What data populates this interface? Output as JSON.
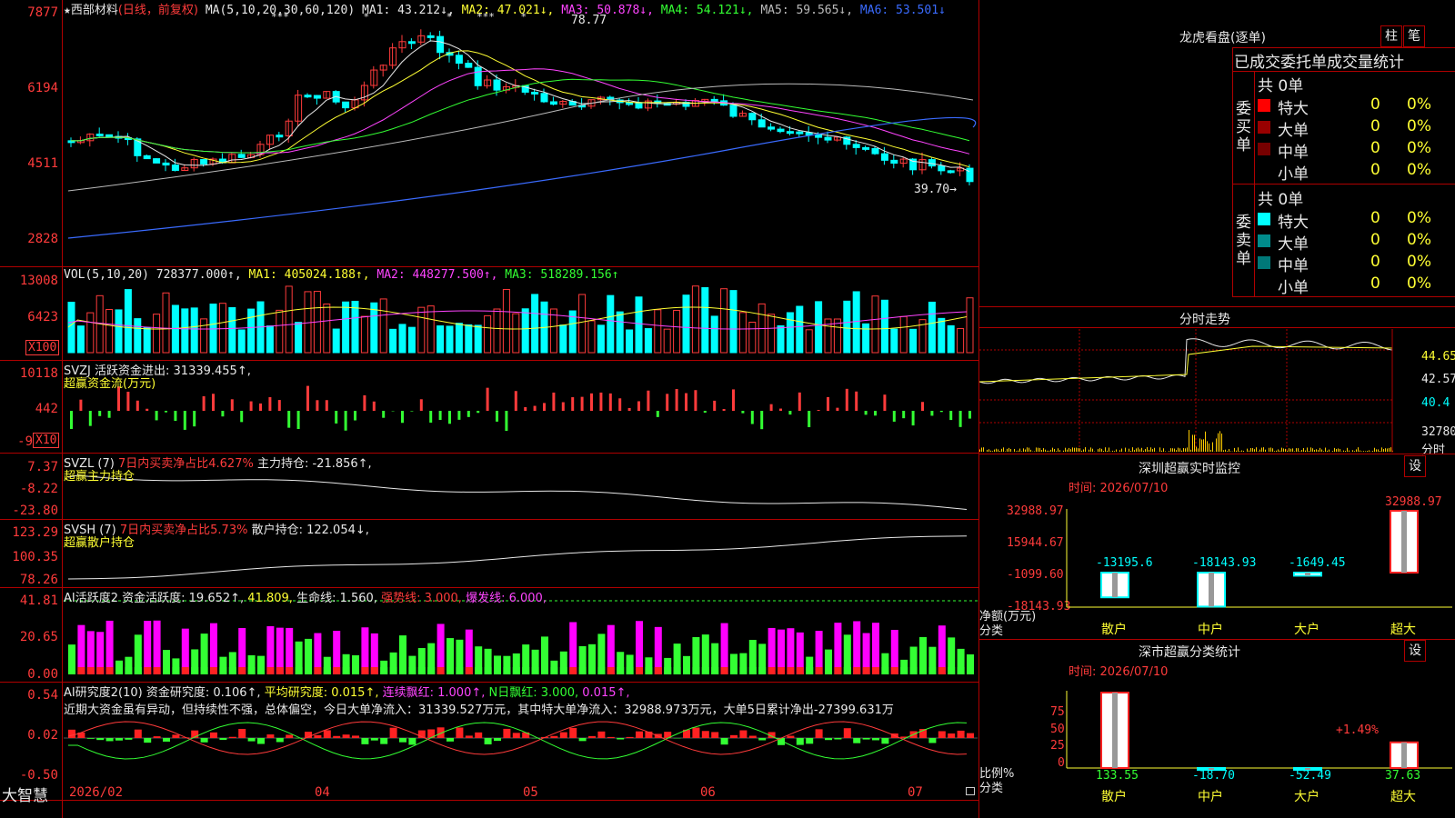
{
  "header": {
    "star": "★",
    "stock_name": "西部材料",
    "mode": "(日线，前复权)",
    "ma_label": "MA(5,10,20,30,60,120)",
    "ma1": "MA1: 43.212↓,",
    "ma2": "MA2: 47.021↓,",
    "ma3": "MA3: 50.878↓,",
    "ma4": "MA4: 54.121↓,",
    "ma5": "MA5: 59.565↓,",
    "ma6": "MA6: 53.501↓",
    "stars": [
      "***",
      "*",
      "*",
      "***",
      "*"
    ],
    "high_mark": "78.77",
    "low_mark": "39.70→"
  },
  "price_axis": [
    "7877",
    "6194",
    "4511",
    "2828"
  ],
  "vol_panel": {
    "label": "VOL(5,10,20)",
    "val": "728377.000↑,",
    "ma1": "MA1: 405024.188↑,",
    "ma2": "MA2: 448277.500↑,",
    "ma3": "MA3: 518289.156↑",
    "axis": [
      "13008",
      "6423"
    ],
    "unit": "X100"
  },
  "svzj_panel": {
    "label": "SVZJ  活跃资金进出: 31339.455↑,",
    "sub": "超赢资金流(万元)",
    "axis": [
      "10118",
      "442",
      "-9"
    ],
    "unit": "X10"
  },
  "svzl_panel": {
    "label": "SVZL (7)",
    "ratio": "7日内买卖净占比4.627%",
    "hold": "主力持仓: -21.856↑,",
    "sub": "超赢主力持仓",
    "axis": [
      "7.37",
      "-8.22",
      "-23.80"
    ]
  },
  "svsh_panel": {
    "label": "SVSH (7)",
    "ratio": "7日内买卖净占比5.73%",
    "hold": "散户持仓: 122.054↓,",
    "sub": "超赢散户持仓",
    "axis": [
      "123.29",
      "100.35",
      "78.26"
    ]
  },
  "ai1_panel": {
    "label": "AI活跃度2 资金活跃度: 19.652↑,",
    "v1": "41.809,",
    "v2": "生命线: 1.560,",
    "v3": "强势线: 3.000,",
    "v4": "爆发线: 6.000,",
    "axis": [
      "41.81",
      "20.65",
      "0.00"
    ]
  },
  "ai2_panel": {
    "label": "AI研究度2(10) 资金研究度: 0.106↑,",
    "avg": "平均研究度: 0.015↑,",
    "red1": "连续飘红: 1.000↑,",
    "red2": "N日飘红: 3.000,",
    "v": "0.015↑,",
    "comment": "近期大资金虽有异动，但持续性不强，总体偏空，今日大单净流入：31339.527万元，其中特大单净流入：32988.973万元，大单5日累计净出-27399.631万",
    "axis": [
      "0.54",
      "0.02",
      "-0.50"
    ]
  },
  "date_axis": {
    "brand": "大智慧",
    "labels": [
      "2026/02",
      "04",
      "05",
      "06",
      "07"
    ]
  },
  "lhb": {
    "title": "龙虎看盘(逐单)",
    "btn1": "柱",
    "btn2": "笔",
    "subtitle": "已成交委托单成交量统计",
    "buy_side": "委买单",
    "sell_side": "委卖单",
    "buy_total": "共 0单",
    "sell_total": "共 0单",
    "buy_rows": [
      {
        "name": "特大",
        "val": "0",
        "pct": "0%",
        "color": "#ff0000"
      },
      {
        "name": "大单",
        "val": "0",
        "pct": "0%",
        "color": "#990000"
      },
      {
        "name": "中单",
        "val": "0",
        "pct": "0%",
        "color": "#770000"
      },
      {
        "name": "小单",
        "val": "0",
        "pct": "0%",
        "color": "#000000"
      }
    ],
    "sell_rows": [
      {
        "name": "特大",
        "val": "0",
        "pct": "0%",
        "color": "#00ffff"
      },
      {
        "name": "大单",
        "val": "0",
        "pct": "0%",
        "color": "#008b8b"
      },
      {
        "name": "中单",
        "val": "0",
        "pct": "0%",
        "color": "#007878"
      },
      {
        "name": "小单",
        "val": "0",
        "pct": "0%",
        "color": "#000000"
      }
    ]
  },
  "intraday": {
    "title": "分时走势",
    "axis": [
      "44.65",
      "42.57",
      "40.4"
    ],
    "vol_axis": "32780",
    "vol_label": "分时"
  },
  "sz_monitor": {
    "title": "深圳超赢实时监控",
    "btn": "设",
    "time": "时间: 2026/07/10",
    "axis": [
      "32988.97",
      "15944.67",
      "-1099.60",
      "-18143.93"
    ],
    "ylabel1": "净额(万元)",
    "ylabel2": "分类",
    "bars": [
      {
        "cat": "散户",
        "value": -13195.6,
        "label": "-13195.6"
      },
      {
        "cat": "中户",
        "value": -18143.93,
        "label": "-18143.93"
      },
      {
        "cat": "大户",
        "value": -1649.45,
        "label": "-1649.45"
      },
      {
        "cat": "超大",
        "value": 32988.97,
        "label": "32988.97"
      }
    ]
  },
  "sz_class": {
    "title": "深市超赢分类统计",
    "btn": "设",
    "time": "时间: 2026/07/10",
    "axis": [
      "75",
      "50",
      "25",
      "0"
    ],
    "ylabel1": "比例%",
    "ylabel2": "分类",
    "big_pct": "+1.49%",
    "bars": [
      {
        "cat": "散户",
        "value": 133.55,
        "label": "133.55"
      },
      {
        "cat": "中户",
        "value": -18.7,
        "label": "-18.70"
      },
      {
        "cat": "大户",
        "value": -52.49,
        "label": "-52.49"
      },
      {
        "cat": "超大",
        "value": 37.63,
        "label": "37.63"
      }
    ]
  }
}
